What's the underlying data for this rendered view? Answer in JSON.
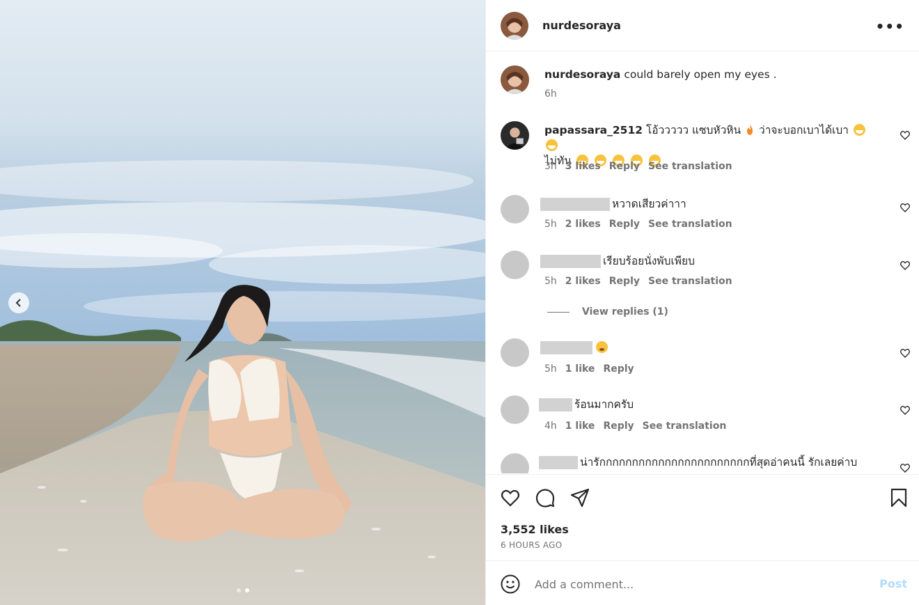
{
  "post": {
    "author": "nurdesoraya",
    "caption": "could barely open my eyes .",
    "caption_time": "6h",
    "likes": "3,552 likes",
    "posted": "6 HOURS AGO"
  },
  "comments": [
    {
      "username": "papassara_2512",
      "text_line1": "โอ้ววววว แซบหัวหิน",
      "text_line1b": "ว่าจะบอกเบาได้เบา",
      "text_line2": "ไม่ทัน",
      "time": "3h",
      "likes": "3 likes",
      "reply": "Reply",
      "translate": "See translation"
    },
    {
      "username_redacted": true,
      "text": "หวาดเสียวค่าาา",
      "time": "5h",
      "likes": "2 likes",
      "reply": "Reply",
      "translate": "See translation"
    },
    {
      "username_redacted": true,
      "text": "เรียบร้อยนั่งพับเพียบ",
      "time": "5h",
      "likes": "2 likes",
      "reply": "Reply",
      "translate": "See translation",
      "view_replies": "View replies (1)"
    },
    {
      "username_redacted": true,
      "text": "",
      "time": "5h",
      "likes": "1 like",
      "reply": "Reply"
    },
    {
      "username_redacted": true,
      "text": "ร้อนมากครับ",
      "time": "4h",
      "likes": "1 like",
      "reply": "Reply",
      "translate": "See translation"
    },
    {
      "username_redacted": true,
      "text": "น่ารักกกกกกกกกกกกกกกกกกกกกกกที่สุดอ่าคนนี้ รักเลยค่าบ"
    }
  ],
  "add_comment": {
    "placeholder": "Add a comment...",
    "post": "Post"
  },
  "icons": {
    "more": "more-options-icon",
    "like": "heart-icon",
    "comment": "comment-icon",
    "share": "share-icon",
    "save": "bookmark-icon",
    "emoji": "emoji-icon",
    "prev": "chevron-left-icon"
  },
  "colors": {
    "accent": "#0095f6",
    "post_disabled": "#b3dbff",
    "muted": "#737373",
    "text": "#262626"
  }
}
